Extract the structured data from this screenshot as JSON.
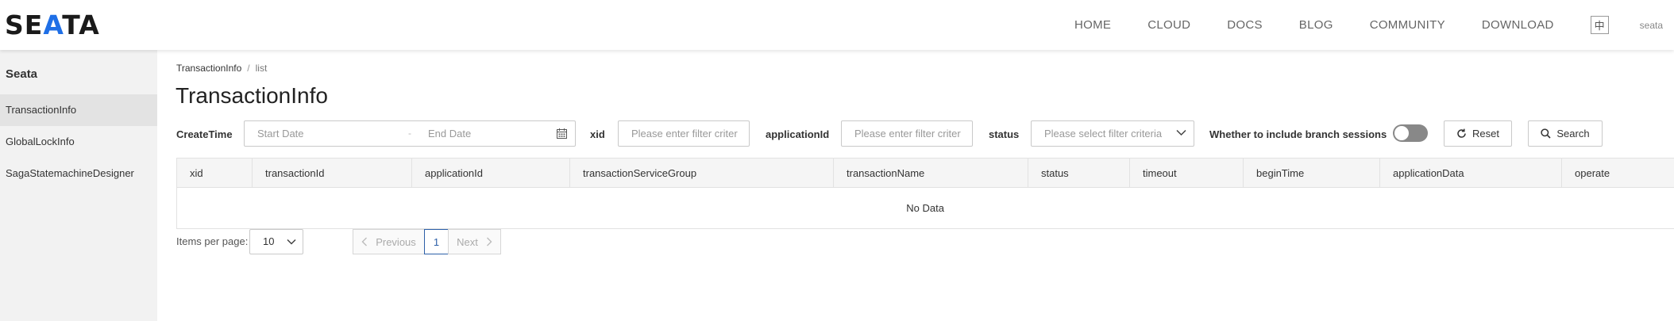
{
  "header": {
    "logo_parts": [
      "SE",
      "A",
      "T",
      "A"
    ],
    "nav": [
      "HOME",
      "CLOUD",
      "DOCS",
      "BLOG",
      "COMMUNITY",
      "DOWNLOAD"
    ],
    "lang_toggle": "中",
    "user": "seata"
  },
  "sidebar": {
    "title": "Seata",
    "items": [
      {
        "label": "TransactionInfo",
        "active": true
      },
      {
        "label": "GlobalLockInfo",
        "active": false
      },
      {
        "label": "SagaStatemachineDesigner",
        "active": false
      }
    ]
  },
  "breadcrumb": {
    "parent": "TransactionInfo",
    "separator": "/",
    "current": "list"
  },
  "page_title": "TransactionInfo",
  "filters": {
    "create_time_label": "CreateTime",
    "start_date_placeholder": "Start Date",
    "date_separator": "-",
    "end_date_placeholder": "End Date",
    "xid_label": "xid",
    "xid_placeholder": "Please enter filter criter",
    "application_id_label": "applicationId",
    "application_id_placeholder": "Please enter filter criter",
    "status_label": "status",
    "status_placeholder": "Please select filter criteria",
    "branch_sessions_label": "Whether to include branch sessions",
    "branch_sessions_on": false,
    "reset_label": "Reset",
    "search_label": "Search"
  },
  "table": {
    "columns": [
      "xid",
      "transactionId",
      "applicationId",
      "transactionServiceGroup",
      "transactionName",
      "status",
      "timeout",
      "beginTime",
      "applicationData",
      "operate"
    ],
    "empty_text": "No Data"
  },
  "pagination": {
    "items_per_page_label": "Items per page:",
    "page_size": "10",
    "previous_label": "Previous",
    "current_page": "1",
    "next_label": "Next"
  },
  "colors": {
    "accent": "#2c5fa8",
    "logo_blue": "#1f6fe6",
    "sidebar_bg": "#f2f2f2"
  }
}
